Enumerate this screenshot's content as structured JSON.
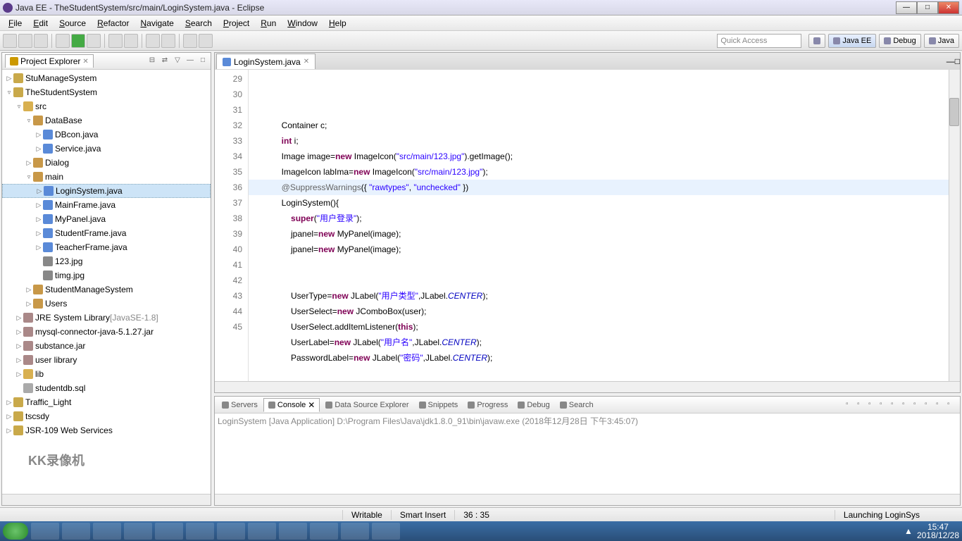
{
  "window": {
    "title": "Java EE - TheStudentSystem/src/main/LoginSystem.java - Eclipse"
  },
  "menu": [
    "File",
    "Edit",
    "Source",
    "Refactor",
    "Navigate",
    "Search",
    "Project",
    "Run",
    "Window",
    "Help"
  ],
  "quickaccess_placeholder": "Quick Access",
  "perspectives": [
    {
      "label": "Java EE",
      "active": true
    },
    {
      "label": "Debug",
      "active": false
    },
    {
      "label": "Java",
      "active": false
    }
  ],
  "project_explorer": {
    "title": "Project Explorer",
    "tree": [
      {
        "lvl": 0,
        "arrow": "▷",
        "icon": "proj",
        "label": "StuManageSystem"
      },
      {
        "lvl": 0,
        "arrow": "▿",
        "icon": "proj",
        "label": "TheStudentSystem"
      },
      {
        "lvl": 1,
        "arrow": "▿",
        "icon": "folder",
        "label": "src"
      },
      {
        "lvl": 2,
        "arrow": "▿",
        "icon": "pkg",
        "label": "DataBase"
      },
      {
        "lvl": 3,
        "arrow": "▷",
        "icon": "java",
        "label": "DBcon.java"
      },
      {
        "lvl": 3,
        "arrow": "▷",
        "icon": "java",
        "label": "Service.java"
      },
      {
        "lvl": 2,
        "arrow": "▷",
        "icon": "pkg",
        "label": "Dialog"
      },
      {
        "lvl": 2,
        "arrow": "▿",
        "icon": "pkg",
        "label": "main"
      },
      {
        "lvl": 3,
        "arrow": "▷",
        "icon": "java",
        "label": "LoginSystem.java",
        "sel": true
      },
      {
        "lvl": 3,
        "arrow": "▷",
        "icon": "java",
        "label": "MainFrame.java"
      },
      {
        "lvl": 3,
        "arrow": "▷",
        "icon": "java",
        "label": "MyPanel.java"
      },
      {
        "lvl": 3,
        "arrow": "▷",
        "icon": "java",
        "label": "StudentFrame.java"
      },
      {
        "lvl": 3,
        "arrow": "▷",
        "icon": "java",
        "label": "TeacherFrame.java"
      },
      {
        "lvl": 3,
        "arrow": "",
        "icon": "img",
        "label": "123.jpg"
      },
      {
        "lvl": 3,
        "arrow": "",
        "icon": "img",
        "label": "timg.jpg"
      },
      {
        "lvl": 2,
        "arrow": "▷",
        "icon": "pkg",
        "label": "StudentManageSystem"
      },
      {
        "lvl": 2,
        "arrow": "▷",
        "icon": "pkg",
        "label": "Users"
      },
      {
        "lvl": 1,
        "arrow": "▷",
        "icon": "jar",
        "label": "JRE System Library",
        "suffix": "[JavaSE-1.8]"
      },
      {
        "lvl": 1,
        "arrow": "▷",
        "icon": "jar",
        "label": "mysql-connector-java-5.1.27.jar"
      },
      {
        "lvl": 1,
        "arrow": "▷",
        "icon": "jar",
        "label": "substance.jar"
      },
      {
        "lvl": 1,
        "arrow": "▷",
        "icon": "jar",
        "label": "user library"
      },
      {
        "lvl": 1,
        "arrow": "▷",
        "icon": "folder",
        "label": "lib"
      },
      {
        "lvl": 1,
        "arrow": "",
        "icon": "file",
        "label": "studentdb.sql"
      },
      {
        "lvl": 0,
        "arrow": "▷",
        "icon": "proj",
        "label": "Traffic_Light"
      },
      {
        "lvl": 0,
        "arrow": "▷",
        "icon": "proj",
        "label": "tscsdy"
      },
      {
        "lvl": 0,
        "arrow": "▷",
        "icon": "proj",
        "label": "JSR-109 Web Services"
      }
    ]
  },
  "editor": {
    "tab": "LoginSystem.java",
    "first_line": 29,
    "lines": [
      {
        "n": 29,
        "html": "        Container c;"
      },
      {
        "n": 30,
        "html": "        <span class='kw'>int</span> i;"
      },
      {
        "n": 31,
        "html": "        Image image=<span class='kw'>new</span> ImageIcon(<span class='str'>\"src/main/123.jpg\"</span>).getImage();"
      },
      {
        "n": 32,
        "html": "        ImageIcon labIma=<span class='kw'>new</span> ImageIcon(<span class='str'>\"src/main/123.jpg\"</span>);"
      },
      {
        "n": 33,
        "html": "        <span class='ann'>@SuppressWarnings</span>({ <span class='str'>\"rawtypes\"</span>, <span class='str'>\"unchecked\"</span> })"
      },
      {
        "n": 34,
        "html": "        LoginSystem(){"
      },
      {
        "n": 35,
        "html": "            <span class='kw'>super</span>(<span class='str'>\"用户登录\"</span>);"
      },
      {
        "n": 36,
        "html": "            jpanel=<span class='kw'>new</span> MyPanel(image);"
      },
      {
        "n": 37,
        "html": "            jpanel=<span class='kw'>new</span> MyPanel(image);"
      },
      {
        "n": 38,
        "html": ""
      },
      {
        "n": 39,
        "html": ""
      },
      {
        "n": 40,
        "html": "            UserType=<span class='kw'>new</span> JLabel(<span class='str'>\"用户类型\"</span>,JLabel.<span class='ital'>CENTER</span>);"
      },
      {
        "n": 41,
        "html": "            UserSelect=<span class='kw'>new</span> JComboBox(user);"
      },
      {
        "n": 42,
        "html": "            UserSelect.addItemListener(<span class='kw'>this</span>);"
      },
      {
        "n": 43,
        "html": "            UserLabel=<span class='kw'>new</span> JLabel(<span class='str'>\"用户名\"</span>,JLabel.<span class='ital'>CENTER</span>);"
      },
      {
        "n": 44,
        "html": "            PasswordLabel=<span class='kw'>new</span> JLabel(<span class='str'>\"密码\"</span>,JLabel.<span class='ital'>CENTER</span>);"
      },
      {
        "n": 45,
        "html": ""
      }
    ]
  },
  "bottom_tabs": [
    "Servers",
    "Console",
    "Data Source Explorer",
    "Snippets",
    "Progress",
    "Debug",
    "Search"
  ],
  "console_launch": "LoginSystem [Java Application] D:\\Program Files\\Java\\jdk1.8.0_91\\bin\\javaw.exe (2018年12月28日 下午3:45:07)",
  "status": {
    "writable": "Writable",
    "insert": "Smart Insert",
    "pos": "36 : 35",
    "launching": "Launching LoginSys"
  },
  "tray": {
    "time": "15:47",
    "date": "2018/12/28"
  },
  "watermark": "KK录像机"
}
